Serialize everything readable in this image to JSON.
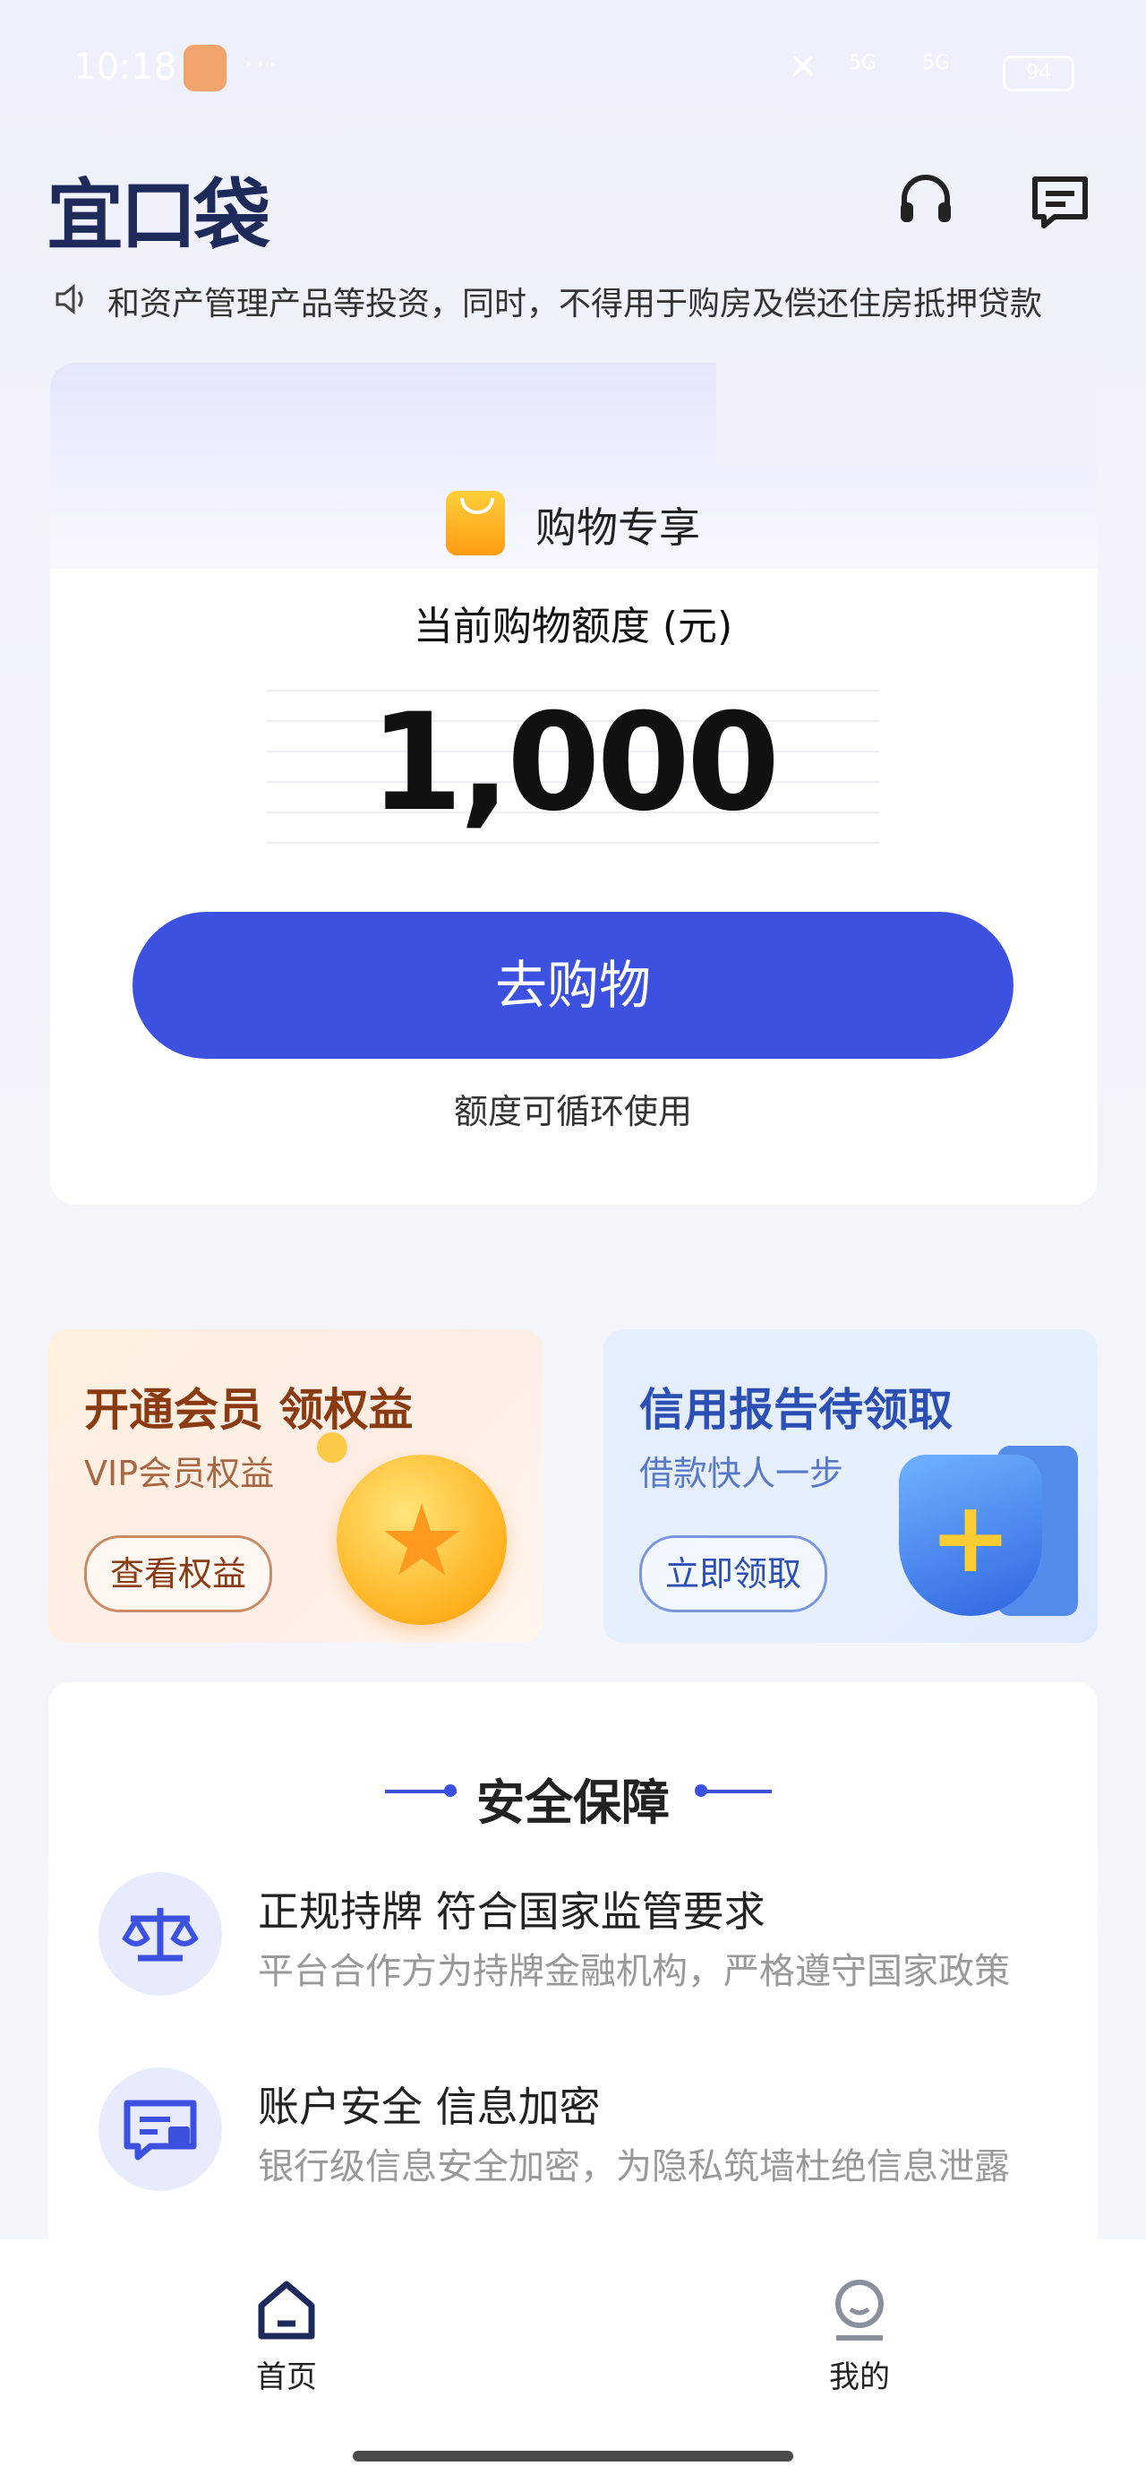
{
  "status_bar": {
    "time": "10:18",
    "dots": "···",
    "signal_1": "5G",
    "signal_2": "5G",
    "battery": "94"
  },
  "header": {
    "logo": "宜口袋",
    "service_icon": "headset-icon",
    "message_icon": "message-icon"
  },
  "notice": {
    "icon": "speaker-icon",
    "text": "和资产管理产品等投资，同时，不得用于购房及偿还住房抵押贷款"
  },
  "shopping_card": {
    "tag_icon": "shopping-bag-icon",
    "tag_label": "购物专享",
    "quota_label": "当前购物额度 (元)",
    "amount": "1,000",
    "go_button": "去购物",
    "cycle_note": "额度可循环使用"
  },
  "promos": [
    {
      "title": "开通会员 领权益",
      "subtitle": "VIP会员权益",
      "button": "查看权益",
      "accent": "#8a3b12"
    },
    {
      "title": "信用报告待领取",
      "subtitle": "借款快人一步",
      "button": "立即领取",
      "accent": "#2c4fb3"
    }
  ],
  "security": {
    "title": "安全保障",
    "items": [
      {
        "icon": "scale-icon",
        "heading": "正规持牌 符合国家监管要求",
        "desc": "平台合作方为持牌金融机构，严格遵守国家政策"
      },
      {
        "icon": "secure-card-icon",
        "heading": "账户安全 信息加密",
        "desc": "银行级信息安全加密，为隐私筑墙杜绝信息泄露"
      }
    ]
  },
  "bottom_nav": [
    {
      "icon": "home-icon",
      "label": "首页"
    },
    {
      "icon": "profile-icon",
      "label": "我的"
    }
  ],
  "colors": {
    "primary": "#3d51e0",
    "logo": "#1e2a5a"
  }
}
